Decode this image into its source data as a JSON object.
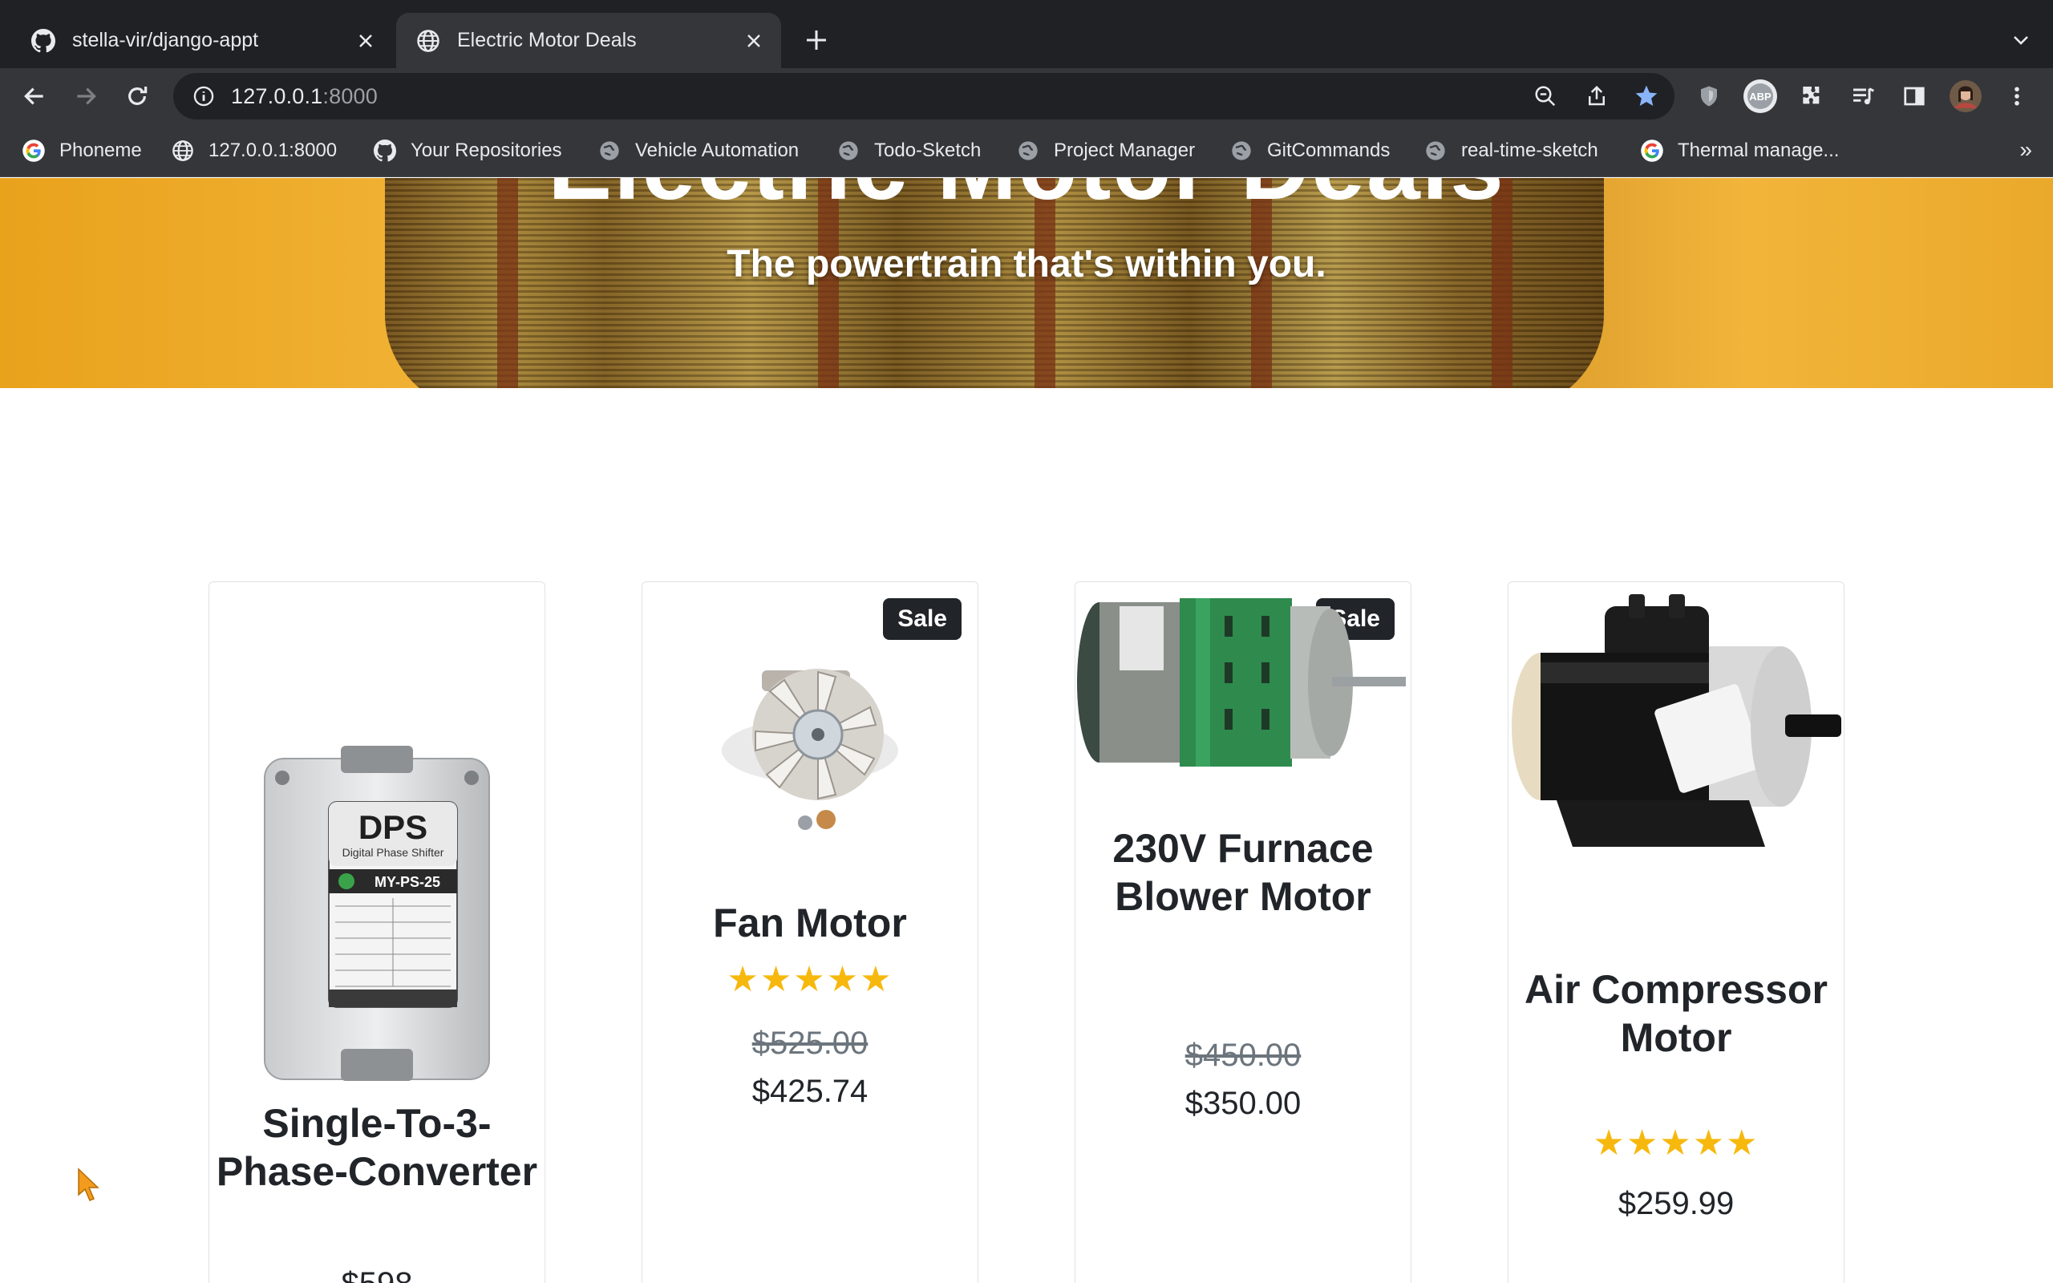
{
  "browser": {
    "tabs": [
      {
        "title": "stella-vir/django-appt",
        "favicon": "github-icon",
        "active": false
      },
      {
        "title": "Electric Motor Deals",
        "favicon": "globe-icon",
        "active": true
      }
    ],
    "url_host": "127.0.0.1",
    "url_port": ":8000",
    "bookmarks": [
      {
        "label": "Phoneme",
        "icon": "google-icon"
      },
      {
        "label": "127.0.0.1:8000",
        "icon": "globe-icon"
      },
      {
        "label": "Your Repositories",
        "icon": "github-icon"
      },
      {
        "label": "Vehicle Automation",
        "icon": "globe-icon"
      },
      {
        "label": "Todo-Sketch",
        "icon": "globe-icon"
      },
      {
        "label": "Project Manager",
        "icon": "globe-icon"
      },
      {
        "label": "GitCommands",
        "icon": "globe-icon"
      },
      {
        "label": "real-time-sketch",
        "icon": "globe-icon"
      },
      {
        "label": "Thermal manage...",
        "icon": "google-icon"
      }
    ],
    "more_bookmarks": "»"
  },
  "hero": {
    "title": "Electric Motor Deals",
    "subtitle": "The powertrain that's within you."
  },
  "products": [
    {
      "name": "Single-To-3-Phase-Converter",
      "sale": false,
      "rating": "★★★★★",
      "old_price": "",
      "price": "$598",
      "image": "phase-converter-image",
      "label_brand": "DPS",
      "label_sub": "Digital Phase Shifter",
      "label_model": "MY-PS-25"
    },
    {
      "name": "Fan Motor",
      "sale": true,
      "badge": "Sale",
      "rating": "★★★★★",
      "old_price": "$525.00",
      "price": "$425.74",
      "image": "fan-motor-image"
    },
    {
      "name": "230V Furnace Blower Motor",
      "sale": true,
      "badge": "Sale",
      "rating": "",
      "old_price": "$450.00",
      "price": "$350.00",
      "image": "blower-motor-image"
    },
    {
      "name": "Air Compressor Motor",
      "sale": false,
      "rating": "★★★★★",
      "old_price": "",
      "price": "$259.99",
      "image": "compressor-motor-image"
    }
  ],
  "colors": {
    "chrome_dark": "#202124",
    "chrome_toolbar": "#35363a",
    "star": "#f7b80e",
    "badge": "#212529"
  }
}
